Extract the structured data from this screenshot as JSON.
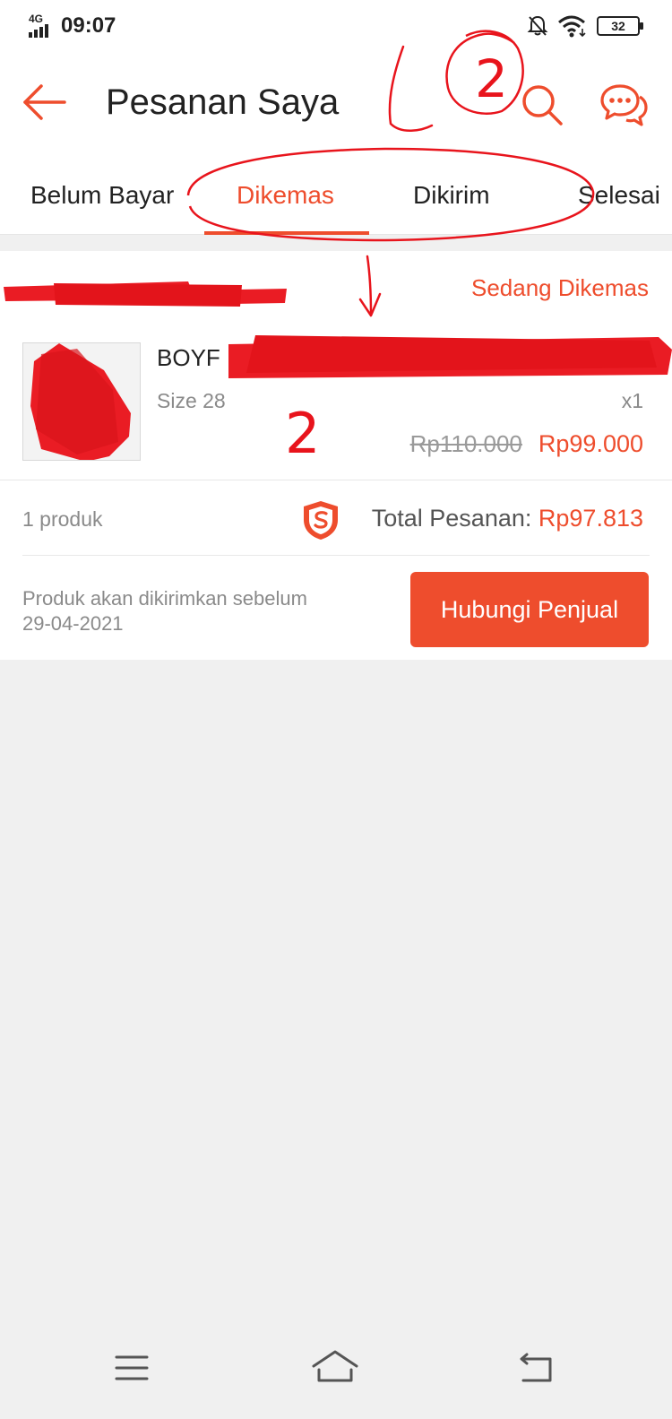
{
  "status_bar": {
    "network": "4G",
    "time": "09:07",
    "battery": "32"
  },
  "header": {
    "title": "Pesanan Saya"
  },
  "tabs": [
    {
      "label": "Belum Bayar",
      "active": false
    },
    {
      "label": "Dikemas",
      "active": true
    },
    {
      "label": "Dikirim",
      "active": false
    },
    {
      "label": "Selesai",
      "active": false
    }
  ],
  "order": {
    "status": "Sedang Dikemas",
    "product_name": "BOYF",
    "variant": "Size 28",
    "quantity": "x1",
    "price_original": "Rp110.000",
    "price_discounted": "Rp99.000",
    "product_count": "1 produk",
    "total_label": "Total Pesanan: ",
    "total_value": "Rp97.813",
    "shipping_note_line1": "Produk akan dikirimkan sebelum",
    "shipping_note_line2": "29-04-2021",
    "contact_button": "Hubungi Penjual"
  },
  "annotations": {
    "handwritten_circle_number": "2",
    "handwritten_number": "2",
    "ink_color": "#e8141c"
  },
  "colors": {
    "accent": "#ee4d2d",
    "background": "#f0f0f0",
    "redaction": "#ea1c24"
  }
}
